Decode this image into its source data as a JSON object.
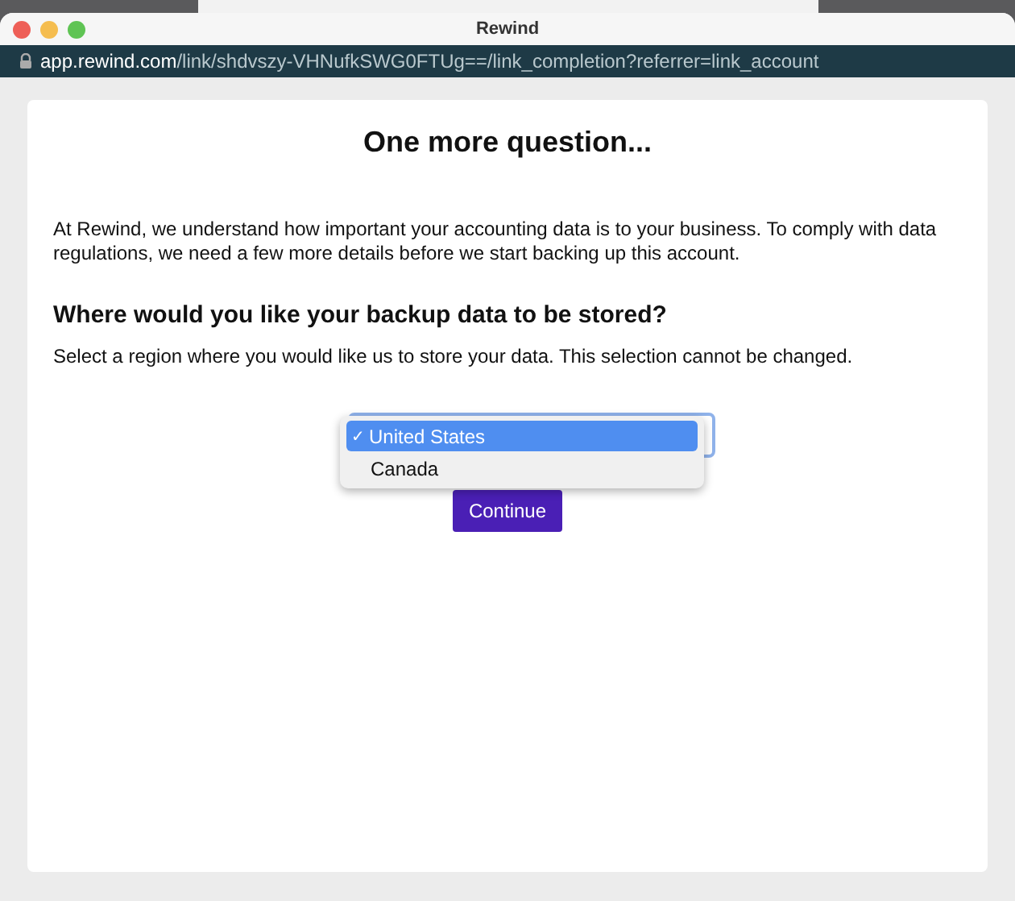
{
  "window": {
    "title": "Rewind"
  },
  "address_bar": {
    "host": "app.rewind.com",
    "path": "/link/shdvszy-VHNufkSWG0FTUg==/link_completion?referrer=link_account"
  },
  "page": {
    "heading": "One more question...",
    "intro": "At Rewind, we understand how important your accounting data is to your business. To comply with data regulations, we need a few more details before we start backing up this account.",
    "question": "Where would you like your backup data to be stored?",
    "hint": "Select a region where you would like us to store your data. This selection cannot be changed.",
    "region_options": [
      {
        "label": "United States",
        "selected": true
      },
      {
        "label": "Canada",
        "selected": false
      }
    ],
    "check_mark": "✓",
    "continue_button": "Continue"
  }
}
